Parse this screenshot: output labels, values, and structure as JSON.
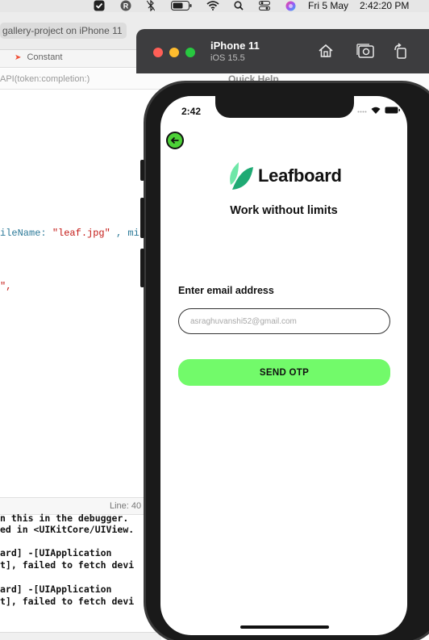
{
  "menubar": {
    "date": "Fri 5 May",
    "time": "2:42:20 PM",
    "icons": [
      "checkbox-icon",
      "r-app-icon",
      "bluetooth-off-icon",
      "battery-icon",
      "wifi-icon",
      "spotlight-icon",
      "control-center-icon",
      "siri-icon"
    ]
  },
  "xcode": {
    "scheme_label": "gallery-project on iPhone 11",
    "tab_label": "Constant",
    "jump_text": "API(token:completion:)",
    "quick_help": "Quick Help",
    "code_line_1_prefix": "ileName: ",
    "code_line_1_string": "\"leaf.jpg\"",
    "code_line_1_suffix": " , mi",
    "code_line_2": "\",",
    "line_indicator": "Line: 40",
    "console": [
      "n this in the debugger.",
      "ed in <UIKitCore/UIView.",
      "",
      "ard] -[UIApplication",
      "t], failed to fetch devi",
      "",
      "ard] -[UIApplication",
      "t], failed to fetch devi"
    ]
  },
  "simulator": {
    "device_name": "iPhone 11",
    "os_version": "iOS 15.5",
    "buttons": [
      "home-icon",
      "screenshot-icon",
      "rotate-icon"
    ]
  },
  "app": {
    "status_time": "2:42",
    "brand_name": "Leafboard",
    "tagline": "Work without limits",
    "email_label": "Enter email address",
    "email_placeholder": "asraghuvanshi52@gmail.com",
    "send_otp_label": "SEND OTP",
    "colors": {
      "accent_green": "#72fa6a",
      "back_button_green": "#4cd137",
      "leaf_dark": "#1faa74",
      "leaf_light": "#6ee7a8"
    }
  }
}
